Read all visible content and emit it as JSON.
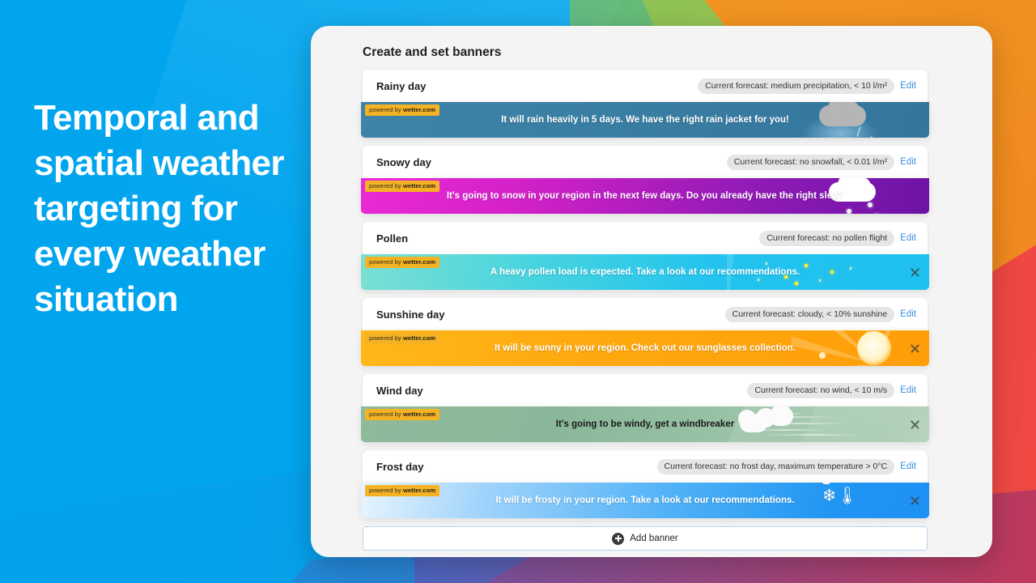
{
  "hero": {
    "headline": "Temporal and spatial weather targeting for every weather situation"
  },
  "panel": {
    "page_title": "Create and set banners",
    "edit_label": "Edit",
    "add_banner_label": "Add banner",
    "badge_prefix": "powered by ",
    "badge_brand": "wetter.com"
  },
  "banners": [
    {
      "title": "Rainy day",
      "forecast": "Current forecast: medium precipitation, < 10 l/m²",
      "message": "It will rain heavily in 5 days. We have the right rain jacket for you!",
      "theme": "rain",
      "accent": "#3a7fa4",
      "has_close": false,
      "text_dark": false
    },
    {
      "title": "Snowy day",
      "forecast": "Current forecast: no snowfall, < 0.01 l/m²",
      "message": "It's going to snow in your region in the next few days.  Do you already have the right sled?",
      "theme": "snow",
      "accent": "#d321c9",
      "has_close": false,
      "text_dark": false
    },
    {
      "title": "Pollen",
      "forecast": "Current forecast: no pollen flight",
      "message": "A heavy pollen load is expected. Take a look at our recommendations.",
      "theme": "pollen",
      "accent": "#22c3ee",
      "has_close": true,
      "text_dark": false
    },
    {
      "title": "Sunshine day",
      "forecast": "Current forecast: cloudy, < 10% sunshine",
      "message": "It will be sunny in your region. Check out our sunglasses collection.",
      "theme": "sun",
      "accent": "#ffa90f",
      "has_close": true,
      "text_dark": false
    },
    {
      "title": "Wind day",
      "forecast": "Current forecast: no wind, < 10 m/s",
      "message": "It's going to be windy, get a windbreaker",
      "theme": "wind",
      "accent": "#8ab79a",
      "has_close": true,
      "text_dark": true
    },
    {
      "title": "Frost day",
      "forecast": "Current forecast: no frost day, maximum temperature > 0°C",
      "message": "It will be frosty in your region. Take a look at our recommendations.",
      "theme": "frost",
      "accent": "#2196f3",
      "has_close": true,
      "text_dark": false
    }
  ]
}
